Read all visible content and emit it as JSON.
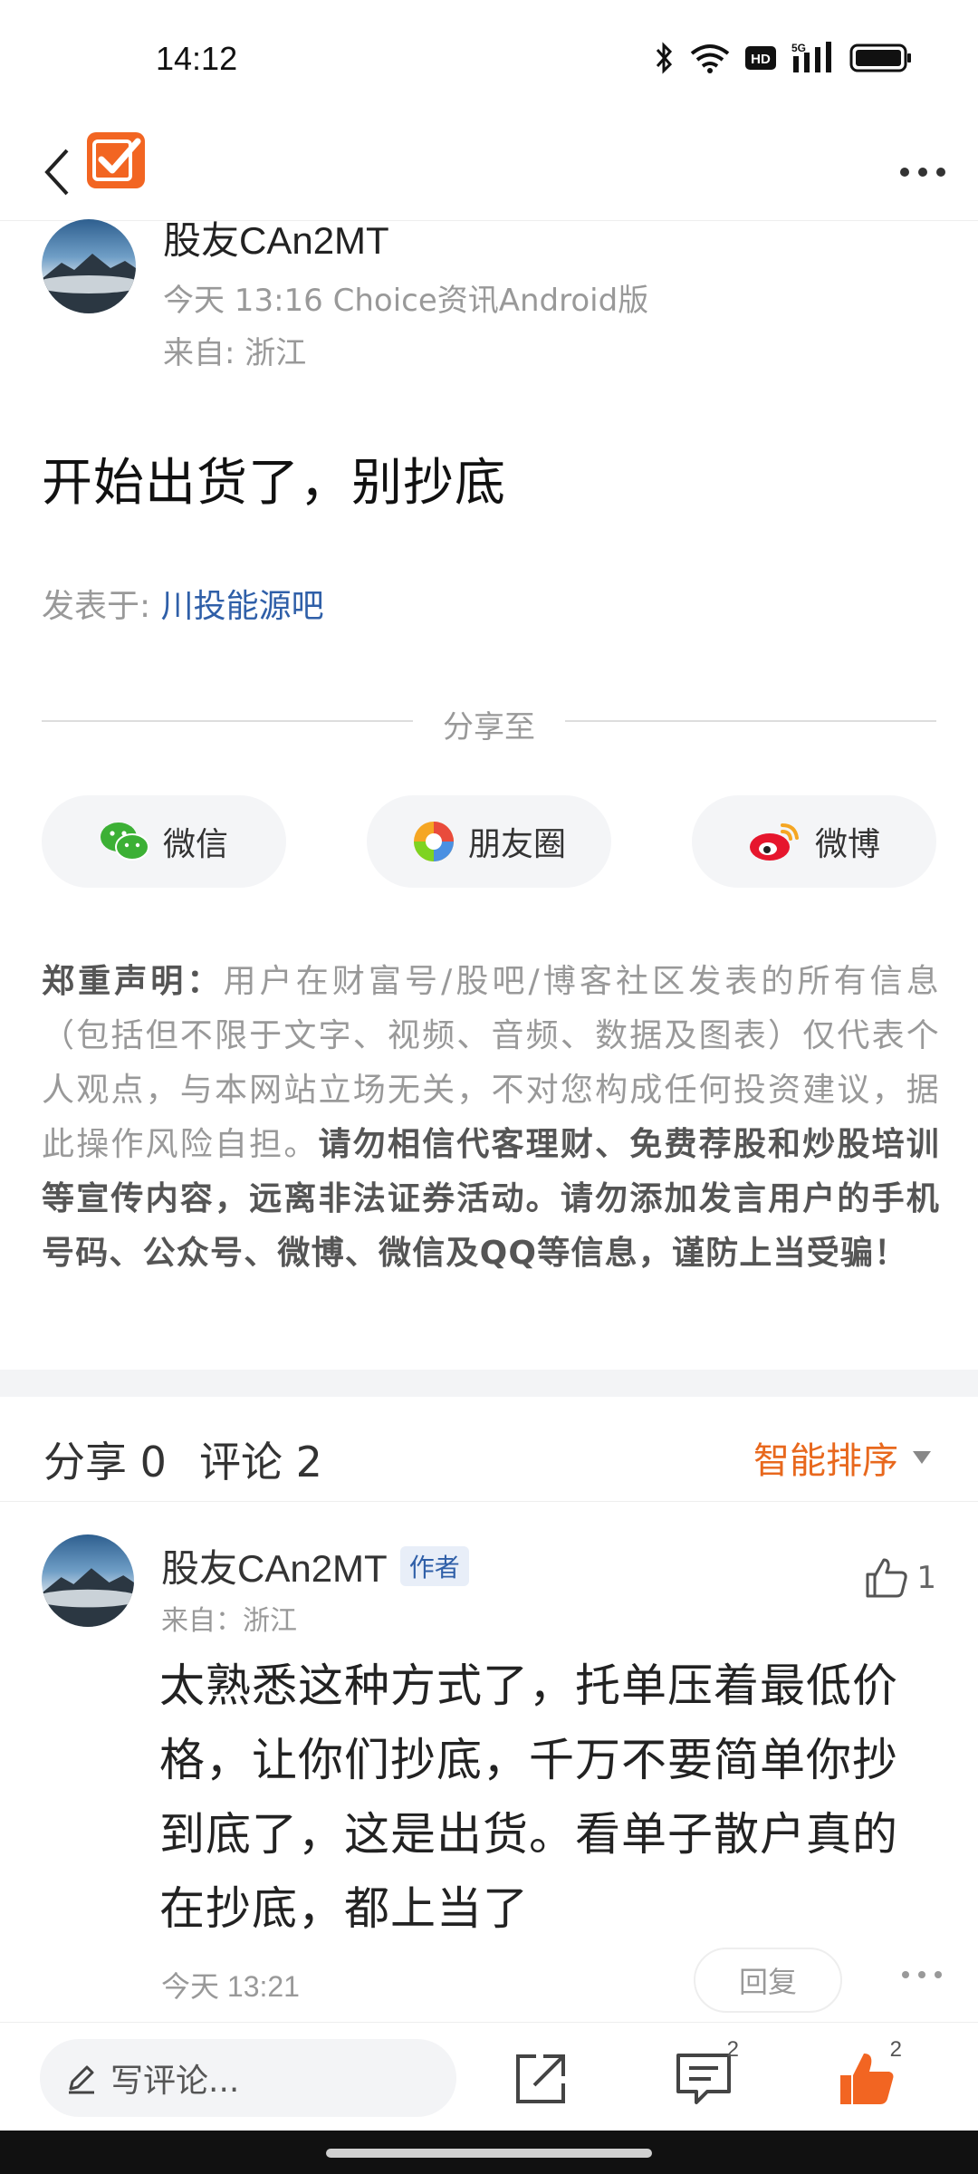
{
  "status_bar": {
    "time": "14:12",
    "network": "5G"
  },
  "post": {
    "author": "股友CAn2MT",
    "meta": "今天 13:16 Choice资讯Android版",
    "location": "来自: 浙江",
    "title": "开始出货了，别抄底",
    "board_prefix": "发表于: ",
    "board_name": "川投能源吧"
  },
  "share": {
    "divider_label": "分享至",
    "buttons": [
      {
        "label": "微信",
        "icon": "wechat-icon"
      },
      {
        "label": "朋友圈",
        "icon": "moments-icon"
      },
      {
        "label": "微博",
        "icon": "weibo-icon"
      }
    ]
  },
  "disclaimer": {
    "heading": "郑重声明：",
    "normal": "用户在财富号/股吧/博客社区发表的所有信息（包括但不限于文字、视频、音频、数据及图表）仅代表个人观点，与本网站立场无关，不对您构成任何投资建议，据此操作风险自担。",
    "emphasis": "请勿相信代客理财、免费荐股和炒股培训等宣传内容，远离非法证券活动。请勿添加发言用户的手机号码、公众号、微博、微信及QQ等信息，谨防上当受骗！"
  },
  "comments_header": {
    "share_label": "分享 0",
    "comment_label": "评论 2",
    "sort_label": "智能排序"
  },
  "comment": {
    "author": "股友CAn2MT",
    "badge": "作者",
    "location": "来自：浙江",
    "likes": "1",
    "text": "太熟悉这种方式了，托单压着最低价格，让你们抄底，千万不要简单你抄到底了，这是出货。看单子散户真的在抄底，都上当了",
    "time": "今天 13:21",
    "reply_label": "回复"
  },
  "bottom_bar": {
    "write_placeholder": "写评论...",
    "comment_count": "2",
    "like_count": "2"
  },
  "colors": {
    "accent": "#e8681d",
    "link": "#2f5fa8",
    "logo": "#f26522"
  }
}
